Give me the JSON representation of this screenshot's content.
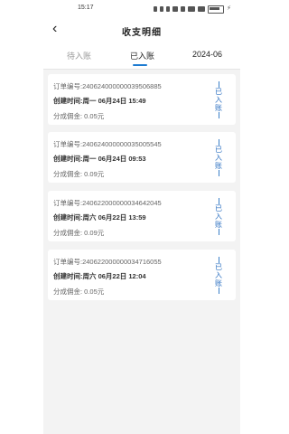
{
  "status_bar": {
    "time": "15:17"
  },
  "header": {
    "back": "‹",
    "title": "收支明细"
  },
  "tabs": [
    {
      "label": "待入账",
      "active": false
    },
    {
      "label": "已入账",
      "active": true
    },
    {
      "label": "2024-06",
      "active": false
    }
  ],
  "records": [
    {
      "order": "订单编号:240624000000039506885",
      "created": "创建时间:周一 06月24日 15:49",
      "commission": "分成佣金: 0.05元",
      "status": [
        "已",
        "入",
        "账"
      ]
    },
    {
      "order": "订单编号:240624000000035005545",
      "created": "创建时间:周一 06月24日 09:53",
      "commission": "分成佣金: 0.09元",
      "status": [
        "已",
        "入",
        "账"
      ]
    },
    {
      "order": "订单编号:240622000000034642045",
      "created": "创建时间:周六 06月22日 13:59",
      "commission": "分成佣金: 0.09元",
      "status": [
        "已",
        "入",
        "账"
      ]
    },
    {
      "order": "订单编号:240622000000034716055",
      "created": "创建时间:周六 06月22日 12:04",
      "commission": "分成佣金: 0.05元",
      "status": [
        "已",
        "入",
        "账"
      ]
    }
  ],
  "colors": {
    "accent": "#1d7bd1",
    "status_text": "#2f72c2",
    "background": "#f3f3f3"
  }
}
